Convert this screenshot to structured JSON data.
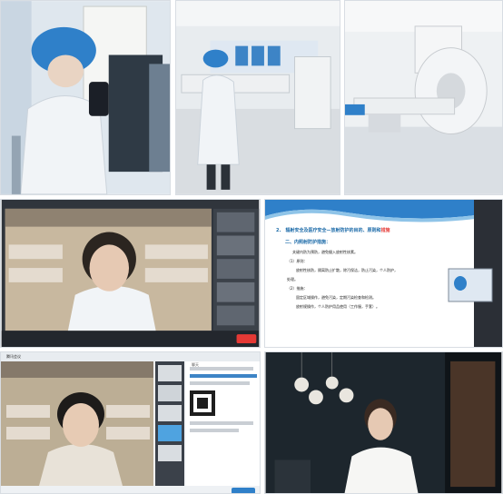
{
  "slide": {
    "title_number": "2.",
    "title_main": "辐射安全及医疗安全—放射防护的目的、原则和",
    "title_highlight": "措施",
    "subheading": "二、内照射防护措施：",
    "intro": "关键内防为预防，避免摄入放射性核素。",
    "principles_heading": "（1）原则：",
    "principles_text": "放射性核防，隔离防止扩散，除污保洁，防止污染，个人防护，",
    "principles_text_2": "处理。",
    "measures_heading": "（2）措施：",
    "measures_text_1": "固定区域操作，避免污染，定期污染检查和检测。",
    "measures_text_2": "放射规操作，个人防护用品使用（工作服，手套）。"
  },
  "meeting_bottom_left": {
    "window_title": "腾讯会议",
    "chat_header": "聊天"
  },
  "colors": {
    "scrub_cap": "#2f80c9",
    "coat": "#f1f4f7",
    "slide_accent": "#1b6aa8",
    "highlight": "#e53935",
    "meeting_bg": "#2b2f36"
  }
}
